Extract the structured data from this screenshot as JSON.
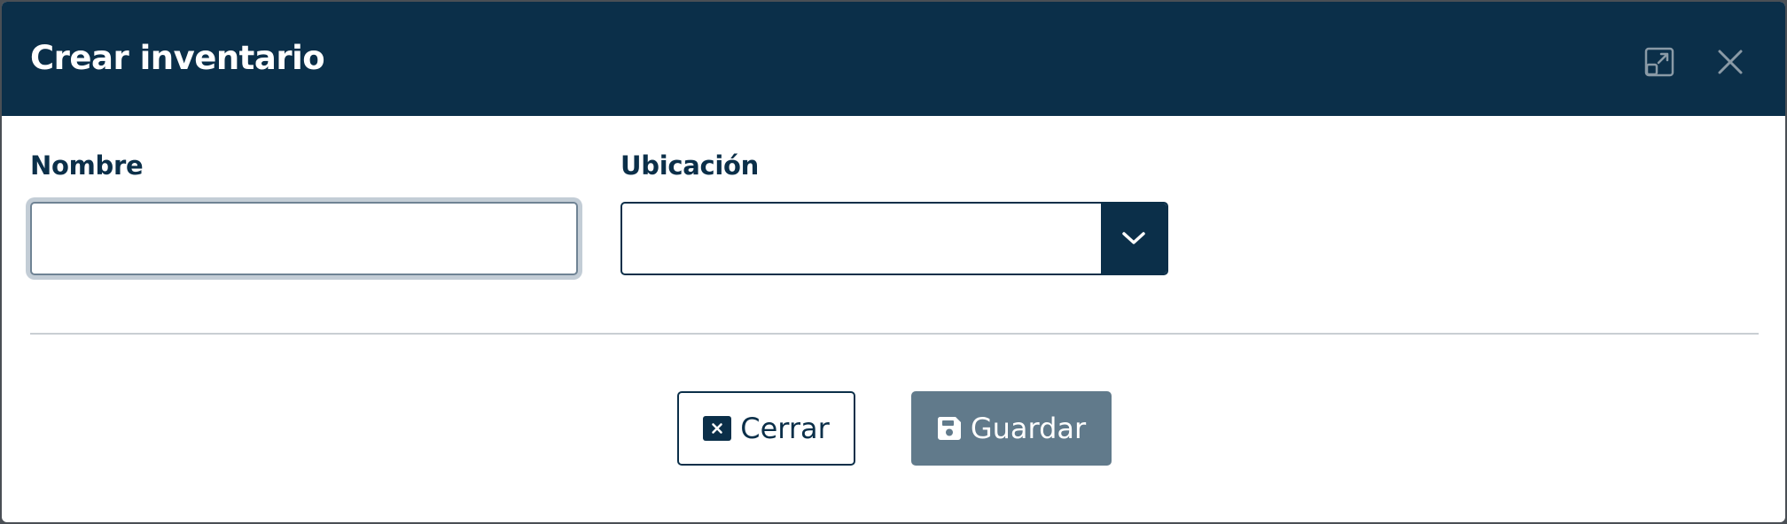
{
  "dialog": {
    "title": "Crear inventario",
    "header_icons": [
      "expand-icon",
      "close-icon"
    ]
  },
  "form": {
    "nombre": {
      "label": "Nombre",
      "value": "",
      "placeholder": ""
    },
    "ubicacion": {
      "label": "Ubicación",
      "selected_value": "",
      "icon": "chevron-down-icon"
    }
  },
  "footer": {
    "cerrar": {
      "label": "Cerrar",
      "icon": "close-square-icon"
    },
    "guardar": {
      "label": "Guardar",
      "icon": "floppy-disk-icon"
    }
  },
  "colors": {
    "header_bg": "#0b2f49",
    "primary": "#0b2f49",
    "save_button_bg": "#617a8b",
    "divider": "#c9cfd3",
    "header_icon": "#8a9aa6"
  }
}
